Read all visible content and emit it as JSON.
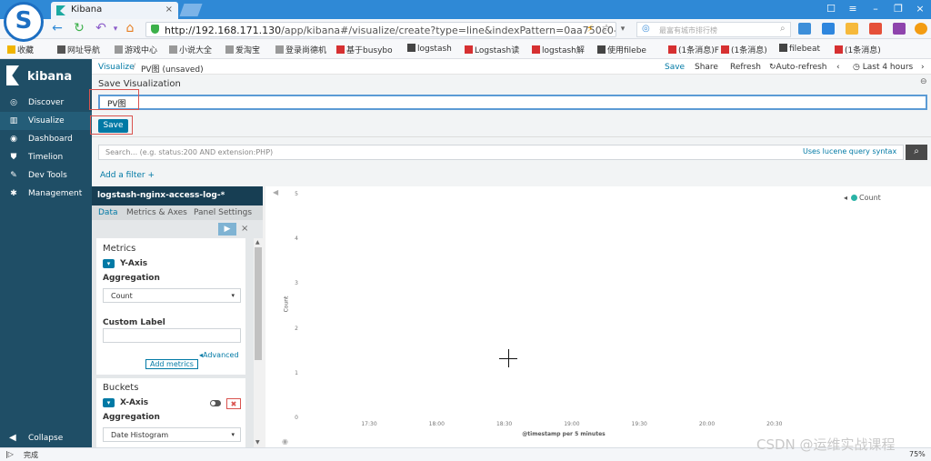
{
  "browser": {
    "tab_title": "Kibana",
    "url_host": "http://192.168.171.130",
    "url_path": "/app/kibana#/visualize/create?type=line&indexPattern=0aa750c0-e",
    "search_placeholder": "最富有城市排行榜",
    "bookmarks": [
      {
        "label": "收藏",
        "color": "#f0b400"
      },
      {
        "label": "网址导航",
        "color": "#555555"
      },
      {
        "label": "游戏中心",
        "color": "#999999"
      },
      {
        "label": "小说大全",
        "color": "#999999"
      },
      {
        "label": "爱淘宝",
        "color": "#999999"
      },
      {
        "label": "登录尚德机",
        "color": "#999999"
      },
      {
        "label": "基于busybo",
        "color": "#d63031"
      },
      {
        "label": "logstash",
        "color": "#444444"
      },
      {
        "label": "Logstash读",
        "color": "#d63031"
      },
      {
        "label": "logstash解",
        "color": "#d63031"
      },
      {
        "label": "使用filebe",
        "color": "#444444"
      },
      {
        "label": "(1条消息)F",
        "color": "#d63031"
      },
      {
        "label": "(1条消息)",
        "color": "#d63031"
      },
      {
        "label": "filebeat",
        "color": "#444444"
      },
      {
        "label": "(1条消息)",
        "color": "#d63031"
      }
    ],
    "status_text": "完成",
    "zoom": "75%"
  },
  "sidebar": {
    "brand": "kibana",
    "items": [
      {
        "label": "Discover",
        "icon": "compass-icon",
        "glyph": "◎"
      },
      {
        "label": "Visualize",
        "icon": "bar-chart-icon",
        "glyph": "▥"
      },
      {
        "label": "Dashboard",
        "icon": "dashboard-icon",
        "glyph": "◉"
      },
      {
        "label": "Timelion",
        "icon": "shield-icon",
        "glyph": "⛊"
      },
      {
        "label": "Dev Tools",
        "icon": "wrench-icon",
        "glyph": "✎"
      },
      {
        "label": "Management",
        "icon": "gear-icon",
        "glyph": "✱"
      }
    ],
    "collapse": "Collapse"
  },
  "topbar": {
    "breadcrumb_root": "Visualize",
    "breadcrumb_sep": "/",
    "breadcrumb_current": "PV图 (unsaved)",
    "save": "Save",
    "share": "Share",
    "refresh": "Refresh",
    "auto_refresh": "Auto-refresh",
    "time": "Last 4 hours"
  },
  "save_panel": {
    "title": "Save Visualization",
    "input_value": "PV图",
    "button": "Save"
  },
  "query": {
    "placeholder": "Search... (e.g. status:200 AND extension:PHP)",
    "syntax_link": "Uses lucene query syntax",
    "add_filter": "Add a filter +"
  },
  "editor": {
    "index_pattern": "logstash-nginx-access-log-*",
    "tabs": [
      "Data",
      "Metrics & Axes",
      "Panel Settings"
    ],
    "metrics_title": "Metrics",
    "y_axis": "Y-Axis",
    "aggregation_label": "Aggregation",
    "aggregation_value": "Count",
    "custom_label": "Custom Label",
    "advanced": "Advanced",
    "add_metrics": "Add metrics",
    "buckets_title": "Buckets",
    "x_axis": "X-Axis",
    "bucket_aggregation_label": "Aggregation",
    "bucket_aggregation_value": "Date Histogram"
  },
  "chart_data": {
    "type": "line",
    "x": [
      "17:30",
      "18:00",
      "18:30",
      "19:00",
      "19:30",
      "20:00",
      "20:30"
    ],
    "series": [
      {
        "name": "Count",
        "values": []
      }
    ],
    "yticks": [
      "5",
      "4",
      "3",
      "2",
      "1",
      "0"
    ],
    "ylim": [
      0,
      5
    ],
    "ylabel": "Count",
    "xlabel": "@timestamp per 5 minutes",
    "legend": "top-right",
    "series_color": "#2ab3a6"
  },
  "watermark": "CSDN @运维实战课程"
}
